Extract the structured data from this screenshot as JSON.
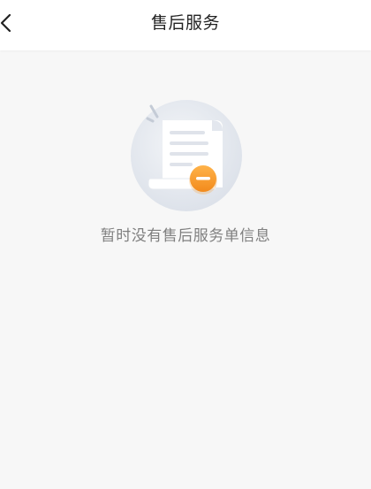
{
  "header": {
    "title": "售后服务",
    "back_icon": "chevron-left-icon"
  },
  "empty_state": {
    "illustration_icon": "empty-document-icon",
    "message": "暂时没有售后服务单信息"
  },
  "colors": {
    "background": "#f7f7f7",
    "header_bg": "#ffffff",
    "accent_orange": "#f79a2c"
  }
}
